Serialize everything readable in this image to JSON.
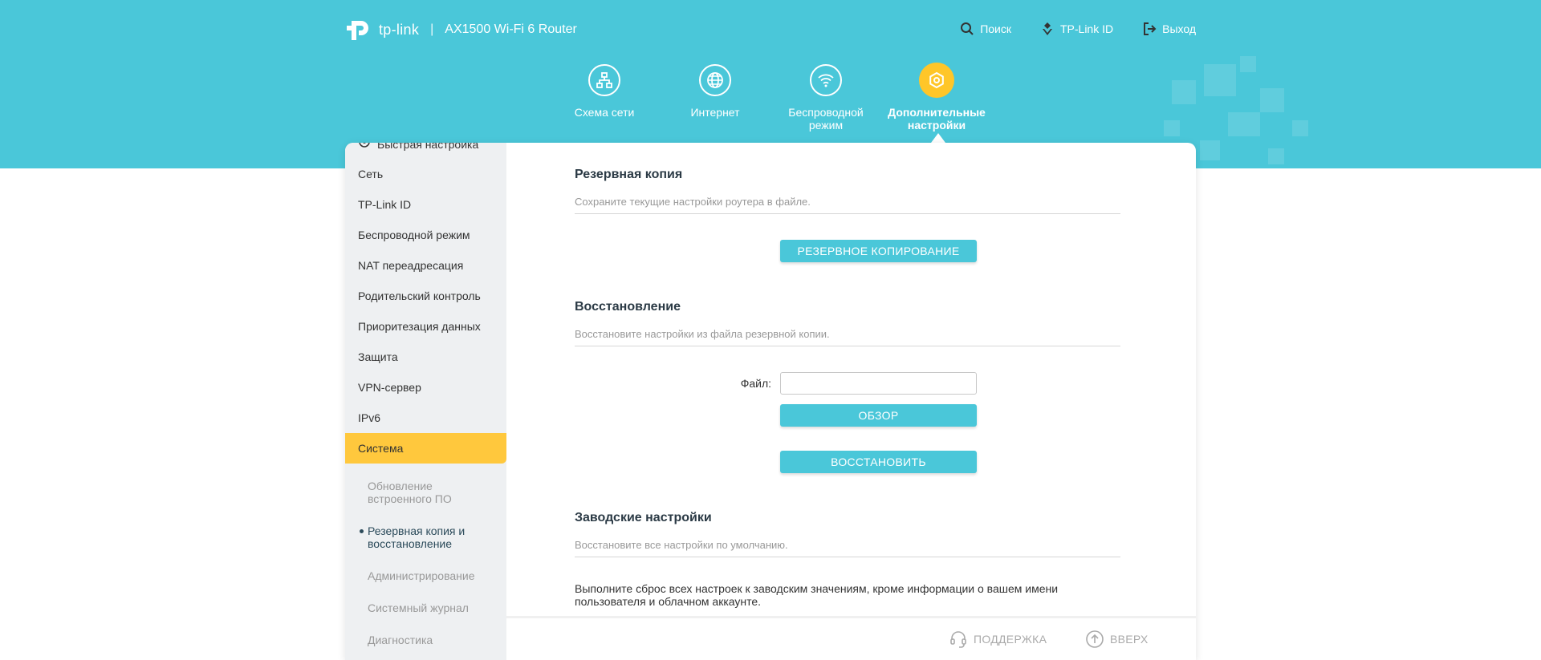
{
  "header": {
    "brand": "tp-link",
    "separator": "|",
    "model": "AX1500 Wi-Fi 6 Router",
    "links": {
      "search": "Поиск",
      "tplink_id": "TP-Link ID",
      "logout": "Выход"
    }
  },
  "nav": {
    "network_map": "Схема сети",
    "internet": "Интернет",
    "wireless": "Беспроводной режим",
    "advanced": "Дополнительные настройки"
  },
  "sidebar": {
    "items": [
      "Быстрая настройка",
      "Сеть",
      "TP-Link ID",
      "Беспроводной режим",
      "NAT переадресация",
      "Родительский контроль",
      "Приоритезация данных",
      "Защита",
      "VPN-сервер",
      "IPv6",
      "Система"
    ],
    "sub_items": [
      "Обновление встроенного ПО",
      "Резервная копия и восстановление",
      "Администрирование",
      "Системный журнал",
      "Диагностика"
    ]
  },
  "backup": {
    "title": "Резервная копия",
    "desc": "Сохраните текущие настройки роутера в файле.",
    "button": "РЕЗЕРВНОЕ КОПИРОВАНИЕ"
  },
  "restore": {
    "title": "Восстановление",
    "desc": "Восстановите настройки из файла резервной копии.",
    "file_label": "Файл:",
    "file_value": "",
    "browse_button": "ОБЗОР",
    "restore_button": "ВОССТАНОВИТЬ"
  },
  "factory": {
    "title": "Заводские настройки",
    "desc": "Восстановите все настройки по умолчанию.",
    "text": "Выполните сброс всех настроек к заводским значениям, кроме информации о вашем имени пользователя и облачном аккаунте."
  },
  "footer": {
    "support": "ПОДДЕРЖКА",
    "top": "ВВЕРХ"
  },
  "colors": {
    "header": "#4ac7d9",
    "accent_yellow": "#ffc83d",
    "button": "#4ac7d9"
  }
}
